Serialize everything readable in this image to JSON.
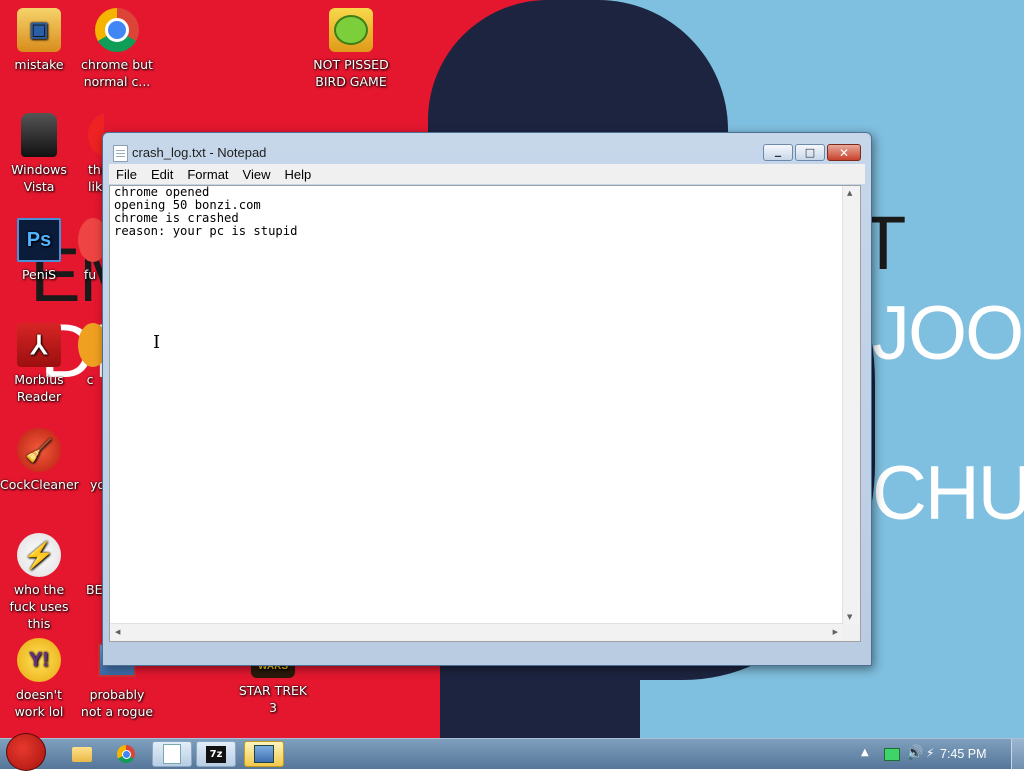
{
  "desktop": {
    "icons": [
      {
        "label": "mistake"
      },
      {
        "label": "chrome but normal c..."
      },
      {
        "label": "NOT PISSED BIRD GAME"
      },
      {
        "label": "Windows Vista"
      },
      {
        "label": "PeniS"
      },
      {
        "label": "Morbius Reader"
      },
      {
        "label": "CockCleaner"
      },
      {
        "label": "who the fuck uses this"
      },
      {
        "label": "doesn't work lol"
      },
      {
        "label": "probably not a rogue"
      },
      {
        "label": "STAR TREK 3"
      },
      {
        "label": "thi like"
      },
      {
        "label": "fu"
      },
      {
        "label": "c"
      },
      {
        "label": "yo"
      },
      {
        "label": "BE"
      }
    ],
    "wallpaper_text": {
      "left": "EM",
      "left2": "DIG",
      "right1": "T",
      "right2": "JOO",
      "right3": "CHUD"
    }
  },
  "notepad": {
    "title": "crash_log.txt - Notepad",
    "menu": [
      "File",
      "Edit",
      "Format",
      "View",
      "Help"
    ],
    "content": "chrome opened\nopening 50 bonzi.com\nchrome is crashed\nreason: your pc is stupid",
    "minimize_glyph": "▁",
    "maximize_glyph": "□",
    "close_glyph": "✕"
  },
  "taskbar": {
    "clock": "7:45 PM",
    "tray_icons": [
      "show-hidden-icons",
      "network-icon",
      "volume-icon",
      "power-icon"
    ],
    "pinned": [
      "explorer-icon",
      "chrome-icon",
      "notepad-icon",
      "7zip-icon",
      "app-icon"
    ],
    "zip_label": "7z"
  },
  "colors": {
    "wallpaper_left": "#e5172f",
    "wallpaper_right": "#7fbfdf",
    "taskbar": "#56769a"
  }
}
